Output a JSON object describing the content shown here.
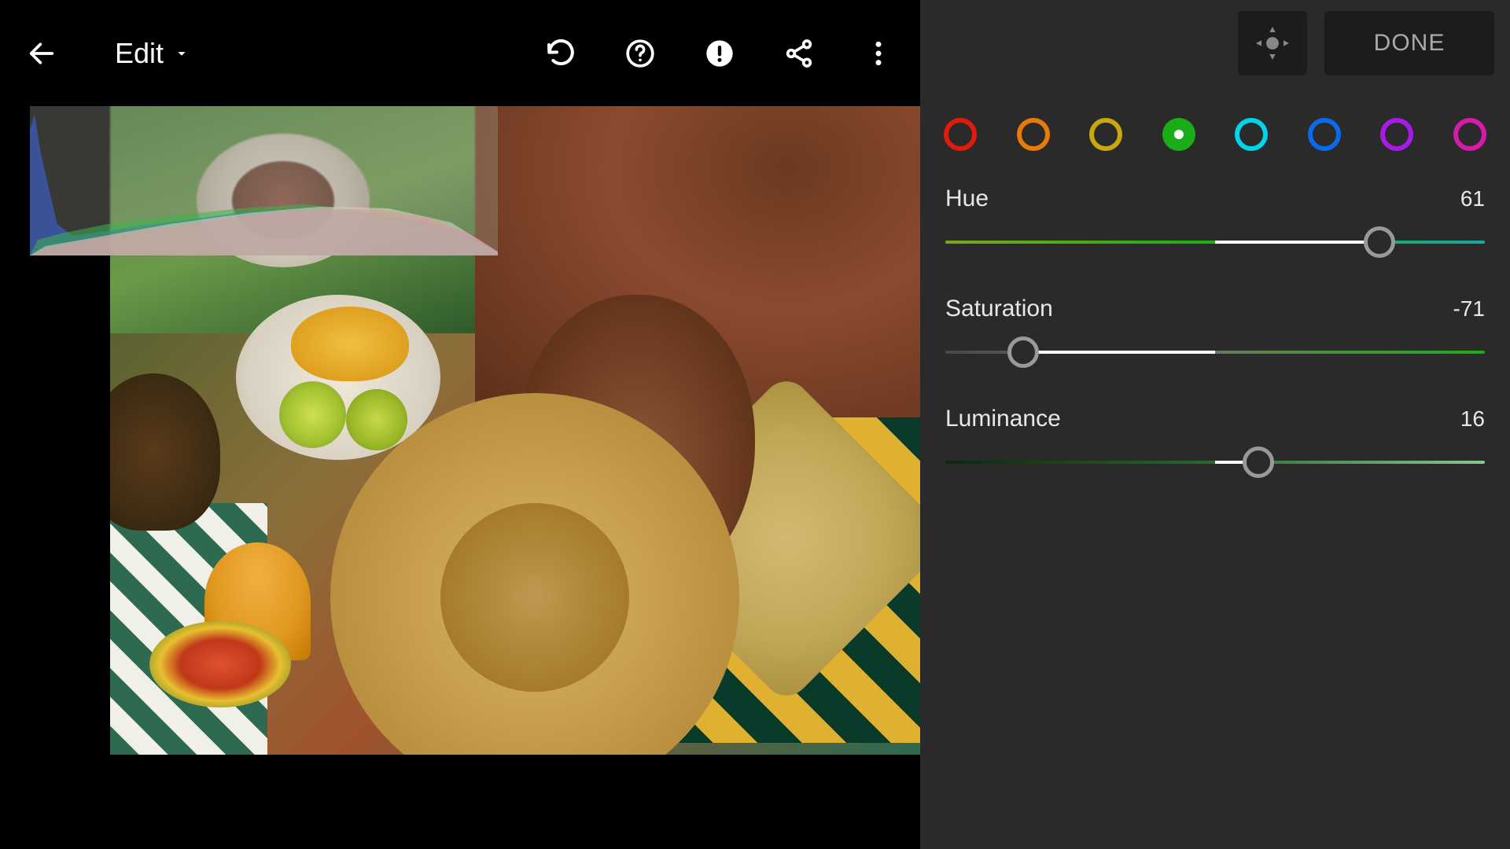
{
  "header": {
    "title": "Edit",
    "done_label": "DONE"
  },
  "color_swatches": [
    {
      "name": "red",
      "color": "#e11b0c",
      "selected": false
    },
    {
      "name": "orange",
      "color": "#e87a0c",
      "selected": false
    },
    {
      "name": "yellow",
      "color": "#c8a80c",
      "selected": false
    },
    {
      "name": "green",
      "color": "#1aad17",
      "selected": true
    },
    {
      "name": "aqua",
      "color": "#00d4e8",
      "selected": false
    },
    {
      "name": "blue",
      "color": "#0c6ae8",
      "selected": false
    },
    {
      "name": "purple",
      "color": "#a81ae8",
      "selected": false
    },
    {
      "name": "magenta",
      "color": "#d81aa8",
      "selected": false
    }
  ],
  "sliders": {
    "hue": {
      "label": "Hue",
      "value": 61,
      "min": -100,
      "max": 100,
      "gradient": "linear-gradient(90deg, #7aa818 0%, #1aad17 50%, #18a8a0 100%)"
    },
    "saturation": {
      "label": "Saturation",
      "value": -71,
      "min": -100,
      "max": 100,
      "gradient": "linear-gradient(90deg, #4a4a4a 0%, #6a7a5a 50%, #1aad17 100%)"
    },
    "luminance": {
      "label": "Luminance",
      "value": 16,
      "min": -100,
      "max": 100,
      "gradient": "linear-gradient(90deg, #0a2a0a 0%, #2a6a2a 50%, #8ac88a 100%)"
    }
  }
}
